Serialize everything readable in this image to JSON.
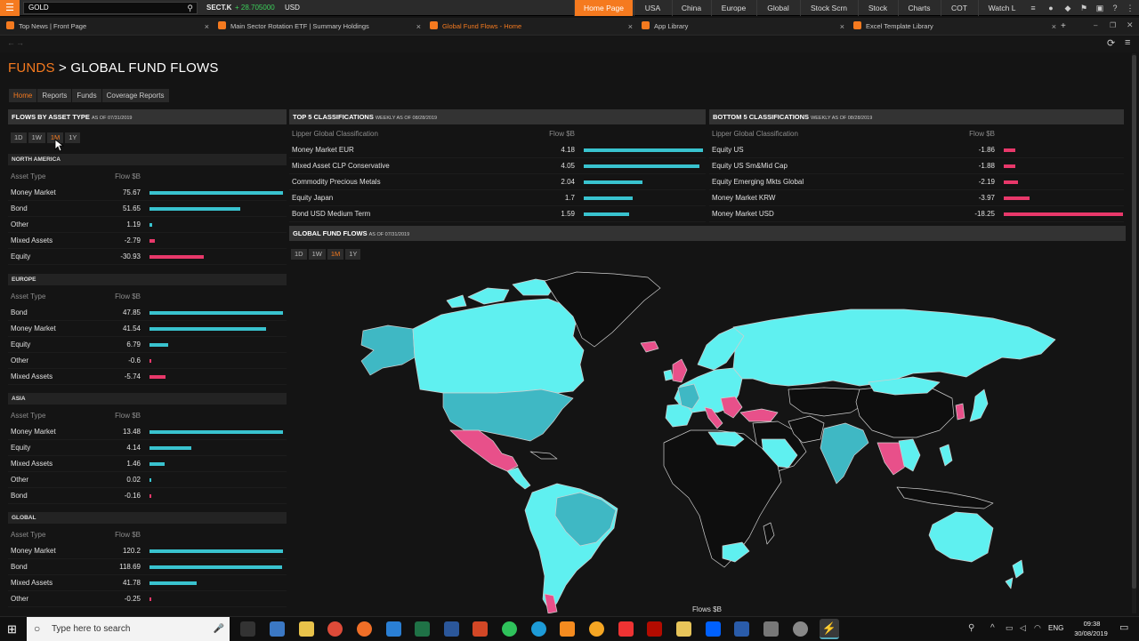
{
  "topbar": {
    "command_value": "GOLD",
    "ticker": "SECT.K",
    "ticker_change": "+ 28.705000",
    "ticker_currency": "USD",
    "nav_tabs": [
      {
        "label": "Home Page",
        "active": true
      },
      {
        "label": "USA"
      },
      {
        "label": "China"
      },
      {
        "label": "Europe"
      },
      {
        "label": "Global"
      },
      {
        "label": "Stock Scrn"
      },
      {
        "label": "Stock"
      },
      {
        "label": "Charts"
      },
      {
        "label": "COT"
      },
      {
        "label": "Watch L"
      }
    ]
  },
  "browser_tabs": [
    {
      "label": "Top News | Front Page"
    },
    {
      "label": "Main Sector Rotation ETF | Summary Holdings"
    },
    {
      "label": "Global Fund Flows - Home",
      "active": true
    },
    {
      "label": "App Library"
    },
    {
      "label": "Excel Template Library"
    }
  ],
  "breadcrumb": {
    "section": "FUNDS",
    "separator": ">",
    "page": "GLOBAL FUND FLOWS"
  },
  "subtabs": [
    {
      "label": "Home",
      "active": true
    },
    {
      "label": "Reports"
    },
    {
      "label": "Funds"
    },
    {
      "label": "Coverage Reports"
    }
  ],
  "flows_by_asset": {
    "title": "FLOWS BY ASSET TYPE",
    "asof": "AS OF 07/31/2019",
    "periods": [
      "1D",
      "1W",
      "1M",
      "1Y"
    ],
    "active_period": "1M",
    "col_type": "Asset Type",
    "col_flow": "Flow $B",
    "regions": [
      {
        "name": "NORTH AMERICA",
        "rows": [
          {
            "type": "Money Market",
            "flow": "75.67",
            "frac": 1.0,
            "sign": "pos"
          },
          {
            "type": "Bond",
            "flow": "51.65",
            "frac": 0.68,
            "sign": "pos"
          },
          {
            "type": "Other",
            "flow": "1.19",
            "frac": 0.02,
            "sign": "pos"
          },
          {
            "type": "Mixed Assets",
            "flow": "-2.79",
            "frac": 0.04,
            "sign": "neg"
          },
          {
            "type": "Equity",
            "flow": "-30.93",
            "frac": 0.41,
            "sign": "neg"
          }
        ]
      },
      {
        "name": "EUROPE",
        "rows": [
          {
            "type": "Bond",
            "flow": "47.85",
            "frac": 1.0,
            "sign": "pos"
          },
          {
            "type": "Money Market",
            "flow": "41.54",
            "frac": 0.87,
            "sign": "pos"
          },
          {
            "type": "Equity",
            "flow": "6.79",
            "frac": 0.14,
            "sign": "pos"
          },
          {
            "type": "Other",
            "flow": "-0.6",
            "frac": 0.013,
            "sign": "neg"
          },
          {
            "type": "Mixed Assets",
            "flow": "-5.74",
            "frac": 0.12,
            "sign": "neg"
          }
        ]
      },
      {
        "name": "ASIA",
        "rows": [
          {
            "type": "Money Market",
            "flow": "13.48",
            "frac": 1.0,
            "sign": "pos"
          },
          {
            "type": "Equity",
            "flow": "4.14",
            "frac": 0.31,
            "sign": "pos"
          },
          {
            "type": "Mixed Assets",
            "flow": "1.46",
            "frac": 0.11,
            "sign": "pos"
          },
          {
            "type": "Other",
            "flow": "0.02",
            "frac": 0.0,
            "sign": "pos"
          },
          {
            "type": "Bond",
            "flow": "-0.16",
            "frac": 0.012,
            "sign": "neg"
          }
        ]
      },
      {
        "name": "GLOBAL",
        "rows": [
          {
            "type": "Money Market",
            "flow": "120.2",
            "frac": 1.0,
            "sign": "pos"
          },
          {
            "type": "Bond",
            "flow": "118.69",
            "frac": 0.99,
            "sign": "pos"
          },
          {
            "type": "Mixed Assets",
            "flow": "41.78",
            "frac": 0.35,
            "sign": "pos"
          },
          {
            "type": "Other",
            "flow": "-0.25",
            "frac": 0.0,
            "sign": "neg"
          }
        ]
      }
    ]
  },
  "top5": {
    "title": "TOP 5 CLASSIFICATIONS",
    "asof": "WEEKLY AS OF 08/28/2019",
    "col_class": "Lipper Global Classification",
    "col_flow": "Flow $B",
    "rows": [
      {
        "name": "Money Market EUR",
        "flow": "4.18",
        "frac": 1.0
      },
      {
        "name": "Mixed Asset CLP Conservative",
        "flow": "4.05",
        "frac": 0.97
      },
      {
        "name": "Commodity Precious Metals",
        "flow": "2.04",
        "frac": 0.49
      },
      {
        "name": "Equity Japan",
        "flow": "1.7",
        "frac": 0.41
      },
      {
        "name": "Bond USD Medium Term",
        "flow": "1.59",
        "frac": 0.38
      }
    ]
  },
  "bottom5": {
    "title": "BOTTOM 5 CLASSIFICATIONS",
    "asof": "WEEKLY AS OF 08/28/2019",
    "col_class": "Lipper Global Classification",
    "col_flow": "Flow $B",
    "rows": [
      {
        "name": "Equity US",
        "flow": "-1.86",
        "frac": 0.1
      },
      {
        "name": "Equity US Sm&Mid Cap",
        "flow": "-1.88",
        "frac": 0.1
      },
      {
        "name": "Equity Emerging Mkts Global",
        "flow": "-2.19",
        "frac": 0.12
      },
      {
        "name": "Money Market KRW",
        "flow": "-3.97",
        "frac": 0.22
      },
      {
        "name": "Money Market USD",
        "flow": "-18.25",
        "frac": 1.0
      }
    ]
  },
  "global_map": {
    "title": "GLOBAL FUND FLOWS",
    "asof": "AS OF 07/31/2019",
    "periods": [
      "1D",
      "1W",
      "1M",
      "1Y"
    ],
    "active_period": "1M",
    "legend_label": "Flows $B",
    "colors": {
      "positive": "#5ff0f0",
      "positive_dark": "#3fb8c4",
      "negative": "#e8508a",
      "land_none": "#0e0e0e",
      "border": "#c8c8c8"
    }
  },
  "taskbar": {
    "search_placeholder": "Type here to search",
    "language": "ENG",
    "time": "09:38",
    "date": "30/08/2019"
  },
  "colors": {
    "accent": "#f57a1f",
    "positive_bar": "#39c3cf",
    "negative_bar": "#e8386a"
  }
}
